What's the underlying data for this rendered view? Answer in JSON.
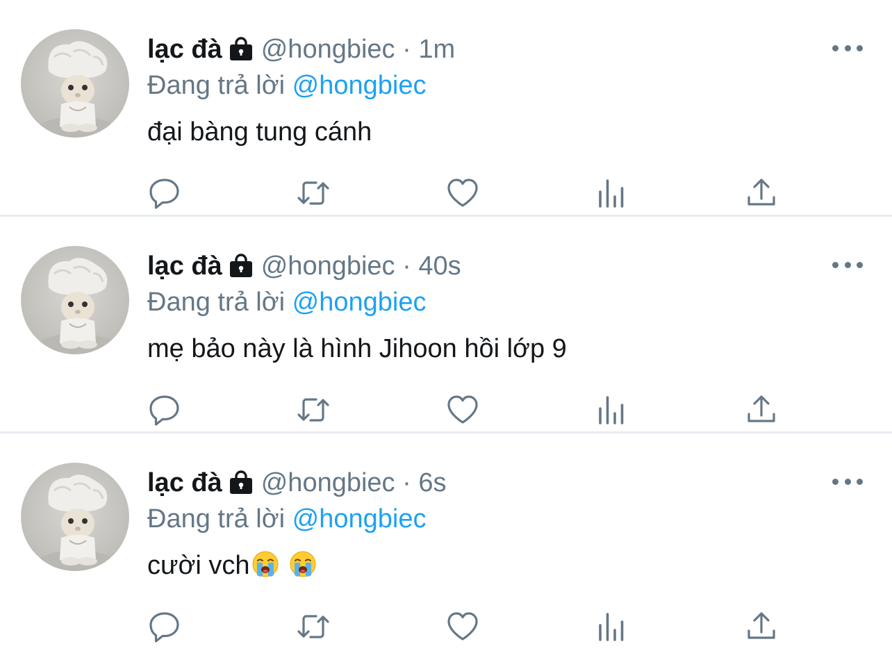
{
  "tweets": [
    {
      "name": "lạc đà",
      "handle": "@hongbiec",
      "time": "· 1m",
      "reply_prefix": "Đang trả lời",
      "reply_to": "@hongbiec",
      "text": "đại bàng tung cánh",
      "emojis": []
    },
    {
      "name": "lạc đà",
      "handle": "@hongbiec",
      "time": "· 40s",
      "reply_prefix": "Đang trả lời",
      "reply_to": "@hongbiec",
      "text": "mẹ bảo này là hình Jihoon hồi lớp 9",
      "emojis": []
    },
    {
      "name": "lạc đà",
      "handle": "@hongbiec",
      "time": "· 6s",
      "reply_prefix": "Đang trả lời",
      "reply_to": "@hongbiec",
      "text": "cười vch",
      "emojis": [
        "loudly-crying-face",
        "loudly-crying-face"
      ]
    }
  ],
  "icons": {
    "lock": "lock-icon",
    "more": "more-icon",
    "actions": [
      "reply-icon",
      "retweet-icon",
      "like-icon",
      "analytics-icon",
      "share-icon"
    ]
  },
  "colors": {
    "text": "#14171a",
    "secondary": "#657786",
    "accent": "#1da1f2",
    "divider": "#e6ecf0"
  }
}
